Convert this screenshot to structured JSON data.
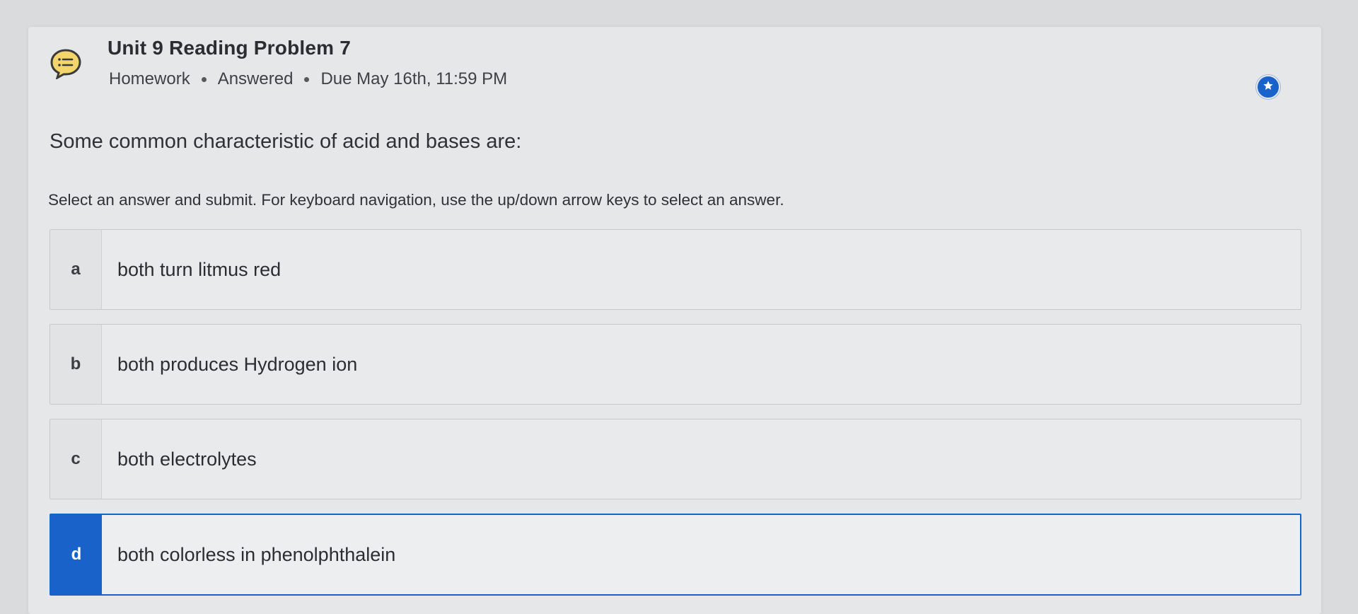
{
  "assignment": {
    "title": "Unit 9 Reading Problem 7",
    "type": "Homework",
    "status": "Answered",
    "due": "Due May 16th, 11:59 PM"
  },
  "question": {
    "prompt": "Some common characteristic of acid and bases are:",
    "instructions": "Select an answer and submit. For keyboard navigation, use the up/down arrow keys to select an answer."
  },
  "options": [
    {
      "letter": "a",
      "text": "both turn litmus red",
      "selected": false
    },
    {
      "letter": "b",
      "text": "both produces Hydrogen ion",
      "selected": false
    },
    {
      "letter": "c",
      "text": "both electrolytes",
      "selected": false
    },
    {
      "letter": "d",
      "text": "both colorless in phenolphthalein",
      "selected": true
    }
  ],
  "icons": {
    "assignment": "chat-list-icon",
    "favorite": "star-icon"
  },
  "colors": {
    "accent": "#1862c9",
    "background": "#d9dbdc",
    "card": "#e6e7e8",
    "icon_yellow": "#f2d56b"
  }
}
